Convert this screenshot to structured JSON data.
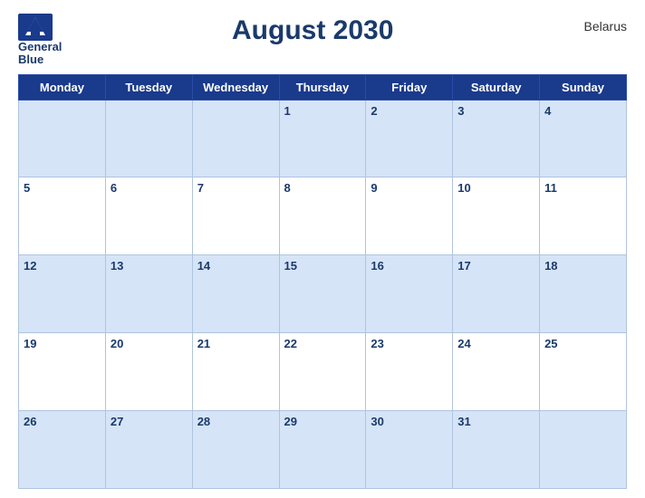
{
  "header": {
    "logo_line1": "General",
    "logo_line2": "Blue",
    "title": "August 2030",
    "country": "Belarus"
  },
  "weekdays": [
    "Monday",
    "Tuesday",
    "Wednesday",
    "Thursday",
    "Friday",
    "Saturday",
    "Sunday"
  ],
  "weeks": [
    [
      null,
      null,
      null,
      1,
      2,
      3,
      4
    ],
    [
      5,
      6,
      7,
      8,
      9,
      10,
      11
    ],
    [
      12,
      13,
      14,
      15,
      16,
      17,
      18
    ],
    [
      19,
      20,
      21,
      22,
      23,
      24,
      25
    ],
    [
      26,
      27,
      28,
      29,
      30,
      31,
      null
    ]
  ]
}
